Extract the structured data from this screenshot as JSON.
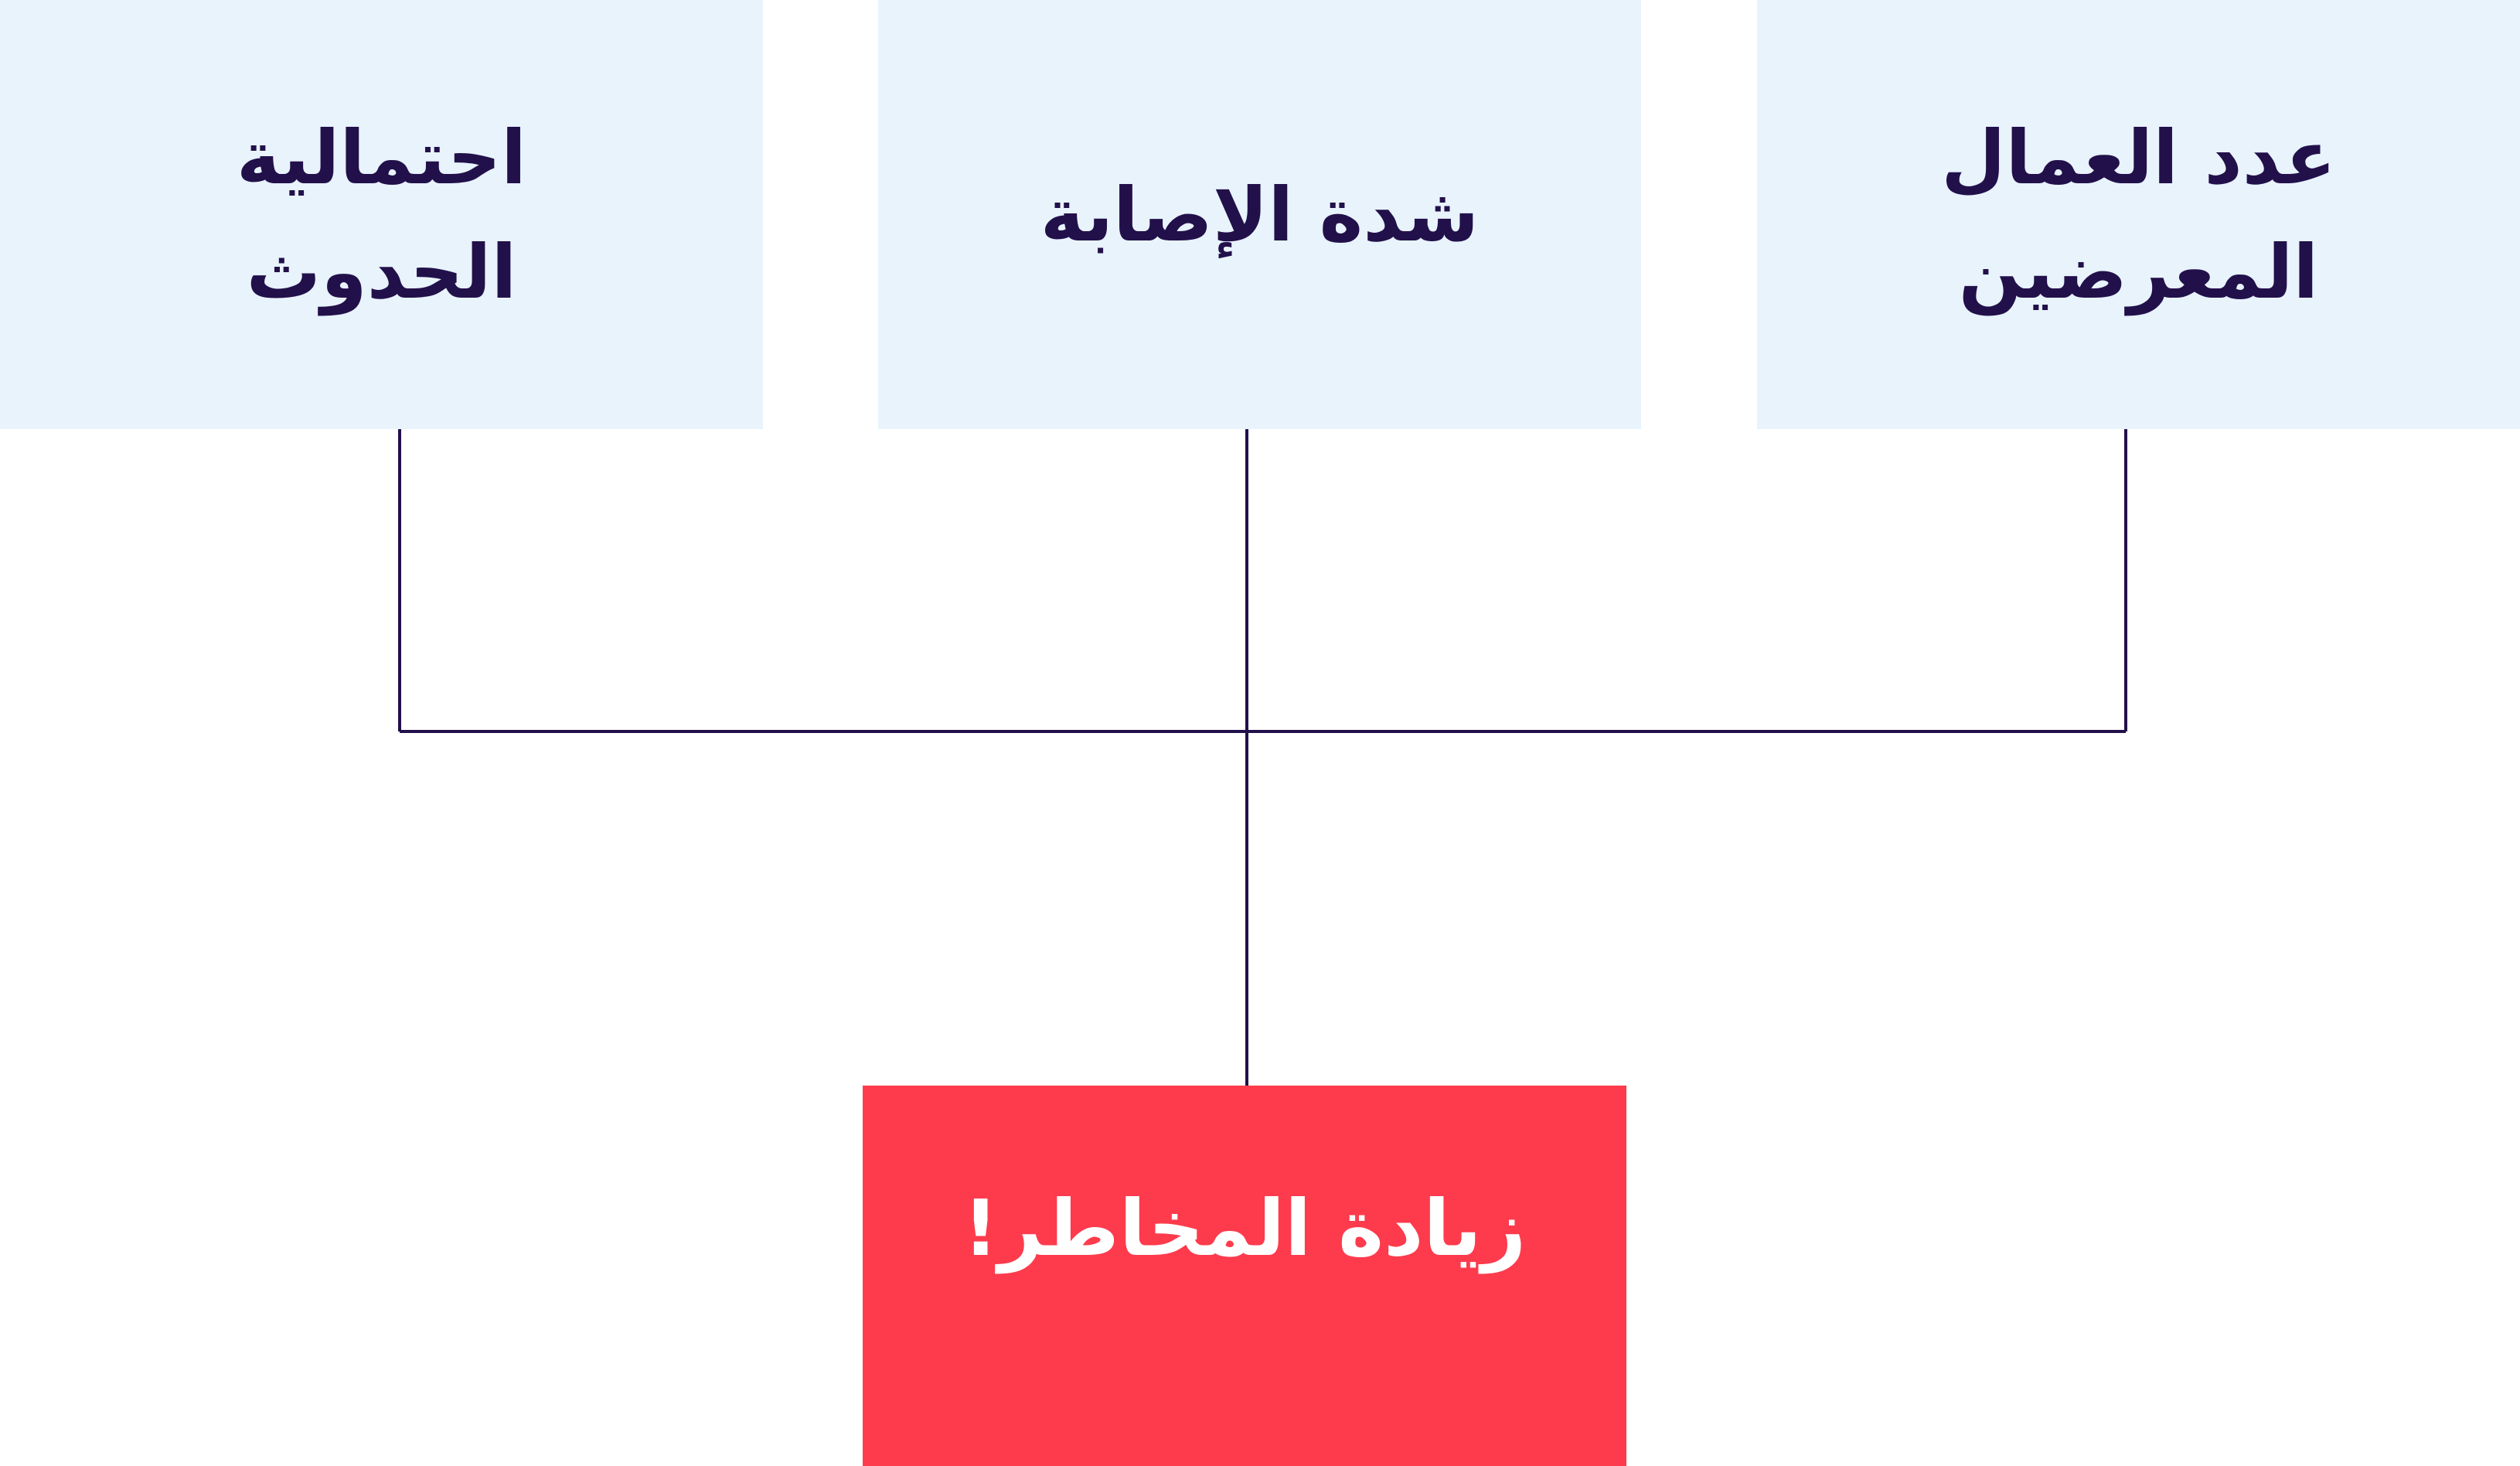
{
  "factors": [
    {
      "label": "احتمالية\nالحدوث"
    },
    {
      "label": "شدة الإصابة"
    },
    {
      "label": "عدد العمال\nالمعرضين"
    }
  ],
  "result": {
    "label": "زيادة المخاطر!"
  },
  "colors": {
    "factor_bg": "#e8f3fc",
    "factor_text": "#22104a",
    "connector": "#22104a",
    "result_bg": "#fd3b4c",
    "result_text": "#ffffff"
  }
}
